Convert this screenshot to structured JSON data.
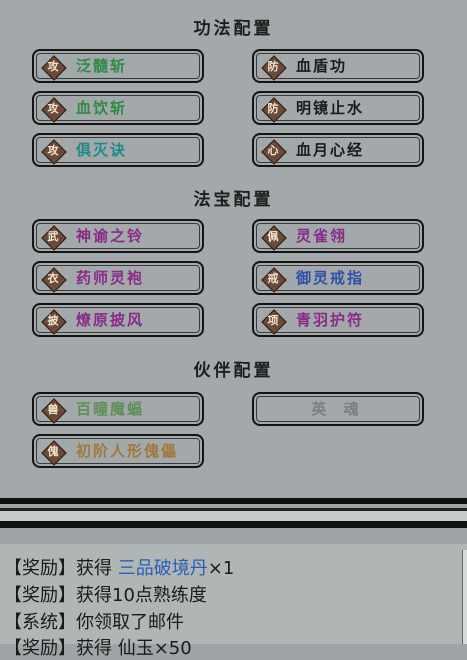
{
  "sections": {
    "gongfa_title": "功法配置",
    "fabao_title": "法宝配置",
    "huoban_title": "伙伴配置"
  },
  "gongfa": [
    {
      "badge": "攻",
      "name": "泛髓斩",
      "color": "#2f8a46"
    },
    {
      "badge": "防",
      "name": "血盾功",
      "color": "#1a1a1a"
    },
    {
      "badge": "攻",
      "name": "血饮斩",
      "color": "#2f8a46"
    },
    {
      "badge": "防",
      "name": "明镜止水",
      "color": "#1a1a1a"
    },
    {
      "badge": "攻",
      "name": "俱灭诀",
      "color": "#1f8a8a"
    },
    {
      "badge": "心",
      "name": "血月心经",
      "color": "#1a1a1a"
    }
  ],
  "fabao": [
    {
      "badge": "武",
      "name": "神谕之铃",
      "color": "#8a2a8a"
    },
    {
      "badge": "佩",
      "name": "灵雀翎",
      "color": "#8a2a8a"
    },
    {
      "badge": "衣",
      "name": "药师灵袍",
      "color": "#8a2a8a"
    },
    {
      "badge": "戒",
      "name": "御灵戒指",
      "color": "#2f4fa8"
    },
    {
      "badge": "披",
      "name": "燎原披风",
      "color": "#8a2a8a"
    },
    {
      "badge": "项",
      "name": "青羽护符",
      "color": "#8a2a8a"
    }
  ],
  "huoban": [
    {
      "badge": "兽",
      "name": "百瞳魔蝠",
      "color": "#5f8f5a"
    },
    {
      "badge": "",
      "name": "英 魂",
      "color": "#7d7f80"
    },
    {
      "badge": "傀",
      "name": "初阶人形傀儡",
      "color": "#a0783a"
    }
  ],
  "log": {
    "line1_prefix": "【奖励】获得 ",
    "line1_item": "三品破境丹",
    "line1_suffix": "×1",
    "line2": "【奖励】获得10点熟练度",
    "line3": "【系统】你领取了邮件",
    "line4": "【奖励】获得 仙玉×50"
  }
}
